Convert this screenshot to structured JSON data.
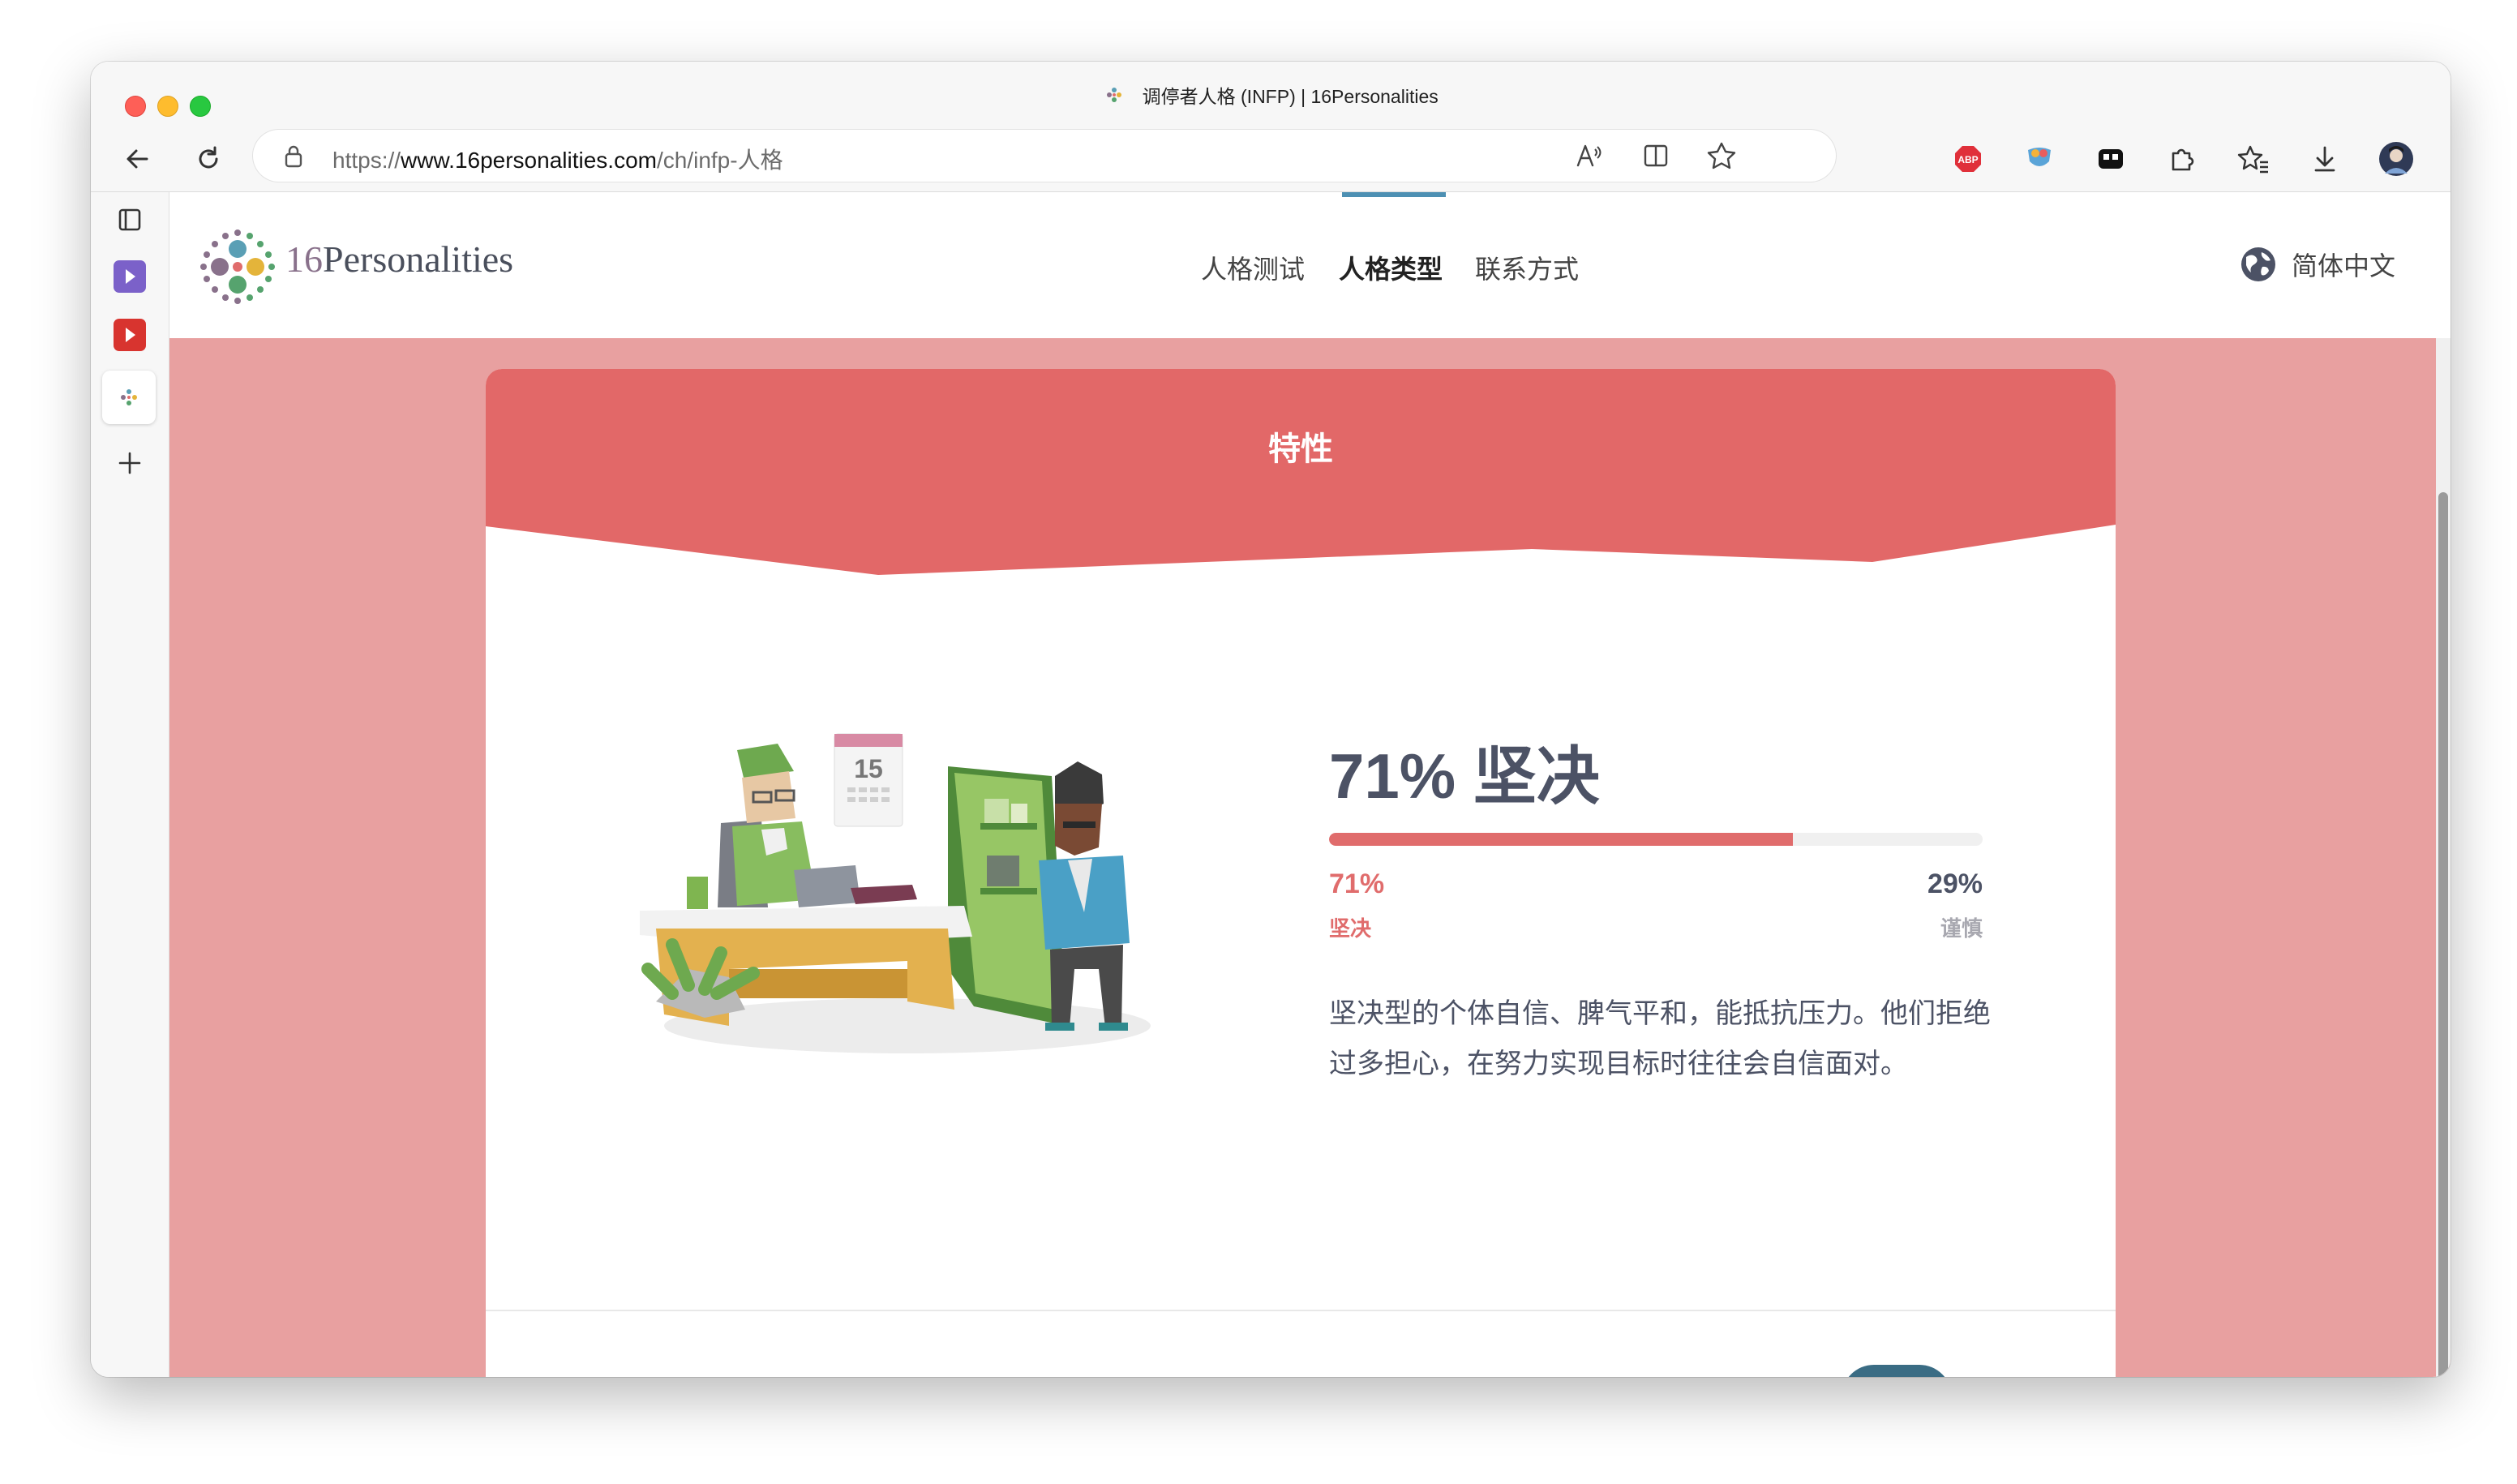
{
  "browser": {
    "tab_title": "调停者人格 (INFP) | 16Personalities",
    "url_prefix": "https://",
    "url_host": "www.16personalities.com",
    "url_path": "/ch/infp-人格",
    "extension_abp": "ABP"
  },
  "site": {
    "logo_number": "16",
    "logo_word": "Personalities",
    "nav": [
      "人格测试",
      "人格类型",
      "联系方式"
    ],
    "active_nav": "人格类型",
    "language": "简体中文"
  },
  "section": {
    "title": "特性",
    "heading": "71% 坚决",
    "left_percent": "71%",
    "left_label": "坚决",
    "right_percent": "29%",
    "right_label": "谨慎",
    "fill_fraction": 0.71,
    "description": "坚决型的个体自信、脾气平和，能抵抗压力。他们拒绝过多担心，在努力实现目标时往往会自信面对。",
    "calendar_day": "15"
  },
  "colors": {
    "accent": "#e06c6c",
    "header_band": "#e26868",
    "page_bg": "#e8a0a0",
    "text_dark": "#4c5265",
    "nav_indicator": "#4d90b3"
  }
}
